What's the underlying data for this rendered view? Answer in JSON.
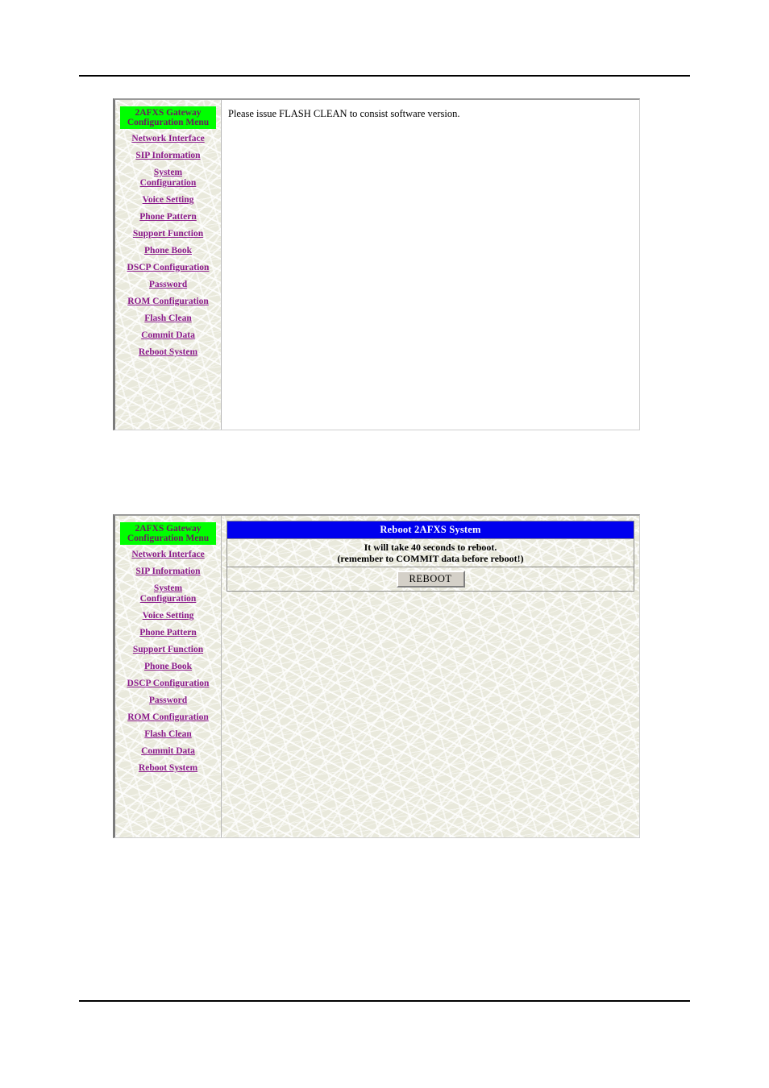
{
  "sidebar": {
    "title_line1": "2AFXS Gateway",
    "title_line2": "Configuration Menu",
    "items": [
      {
        "label": "Network Interface",
        "line2": ""
      },
      {
        "label": "SIP Information",
        "line2": ""
      },
      {
        "label": "System",
        "line2": "Configuration"
      },
      {
        "label": "Voice Setting",
        "line2": ""
      },
      {
        "label": "Phone Pattern",
        "line2": ""
      },
      {
        "label": "Support Function",
        "line2": ""
      },
      {
        "label": "Phone Book",
        "line2": ""
      },
      {
        "label": "DSCP Configuration",
        "line2": ""
      },
      {
        "label": "Password",
        "line2": ""
      },
      {
        "label": "ROM Configuration",
        "line2": ""
      },
      {
        "label": "Flash Clean",
        "line2": ""
      },
      {
        "label": "Commit Data",
        "line2": ""
      },
      {
        "label": "Reboot System",
        "line2": ""
      }
    ]
  },
  "flash_panel": {
    "message": "Please issue FLASH CLEAN to consist software version."
  },
  "reboot_panel": {
    "header": "Reboot 2AFXS System",
    "info_line1": "It will take 40 seconds to reboot.",
    "info_line2": "(remember to COMMIT data before reboot!)",
    "button_label": "REBOOT"
  },
  "colors": {
    "menu_title_bg": "#00ff00",
    "menu_title_text": "#6a1b5e",
    "link": "#8b1a8b",
    "reboot_header_bg": "#0000ee",
    "reboot_header_text": "#ffffff",
    "texture_bg": "#e9e9dc",
    "rule": "#000000"
  }
}
